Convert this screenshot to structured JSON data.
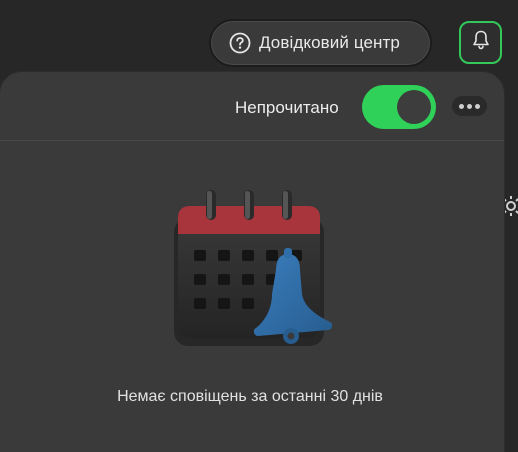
{
  "header": {
    "help_center_label": "Довідковий центр",
    "help_icon": "question-circle-icon",
    "notifications_icon": "bell-icon"
  },
  "notifications_panel": {
    "unread_label": "Непрочитано",
    "unread_toggle_on": true,
    "more_icon": "more-dots-icon",
    "empty_message": "Немає сповіщень за останні 30 днів",
    "illustration": "calendar-bell-illustration"
  },
  "colors": {
    "accent_green": "#30d158",
    "calendar_top_red": "#a8343c",
    "bell_blue": "#2f6ea8"
  }
}
